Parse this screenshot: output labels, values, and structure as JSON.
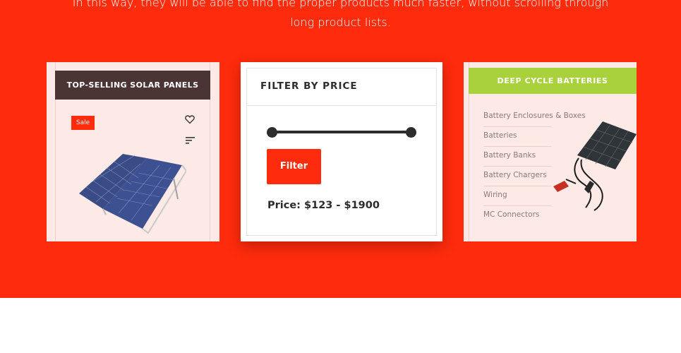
{
  "intro": {
    "line1": "In this way, they will be able to find the proper products much faster, without scrolling through",
    "line2": "long product lists."
  },
  "left_card": {
    "title": "TOP-SELLING SOLAR PANELS",
    "badge": "Sale",
    "icons": [
      "heart-icon",
      "sort-icon"
    ]
  },
  "filter_card": {
    "title": "FILTER BY PRICE",
    "slider": {
      "min_fraction": 0.0,
      "max_fraction": 1.0
    },
    "button_label": "Filter",
    "price_text": "Price: $123 - $1900"
  },
  "right_card": {
    "title": "DEEP CYCLE BATTERIES",
    "categories": [
      "Battery Enclosures & Boxes",
      "Batteries",
      "Battery Banks",
      "Battery Chargers",
      "Wiring",
      "MC Connectors"
    ]
  },
  "colors": {
    "accent": "#fe2b0c",
    "dark_header": "#4a3434",
    "green_header": "#a8d13c",
    "card_bg": "#fde9e6"
  }
}
